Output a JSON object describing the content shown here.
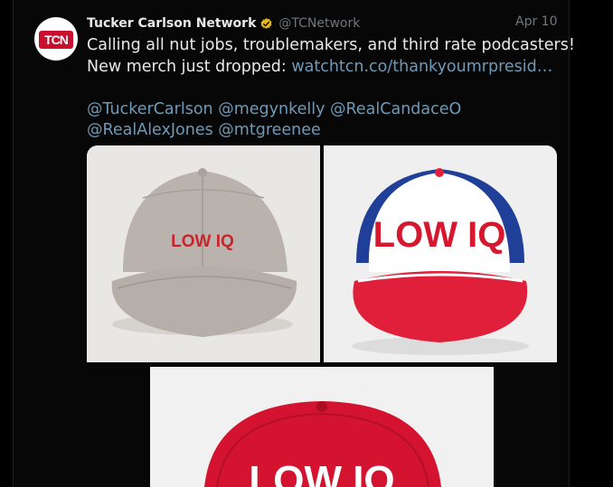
{
  "tweet": {
    "avatar_label": "TCN",
    "author_name": "Tucker Carlson Network",
    "author_handle": "@TCNetwork",
    "date": "Apr 10",
    "verified_icon": "verified-badge-icon",
    "text_line1": "Calling all nut jobs, troublemakers, and third rate podcasters!",
    "text_line2_prefix": "New merch just dropped: ",
    "link": "watchtcn.co/thankyoumrpresid…",
    "mentions_line1": [
      "@TuckerCarlson",
      "@megynkelly",
      "@RealCandaceO"
    ],
    "mentions_line2": [
      "@RealAlexJones",
      "@mtgreenee"
    ]
  },
  "media": [
    {
      "hat_text": "LOW IQ",
      "style": "grey dad cap"
    },
    {
      "hat_text": "LOW IQ",
      "style": "white-blue-red trucker cap"
    },
    {
      "hat_text": "LOW IQ",
      "style": "red trucker cap"
    }
  ],
  "colors": {
    "background": "#000000",
    "text": "#e7e9ea",
    "muted": "#71767b",
    "link": "#6f99b7",
    "brand_red": "#c8102e",
    "verified_gold": "#e2b719"
  }
}
